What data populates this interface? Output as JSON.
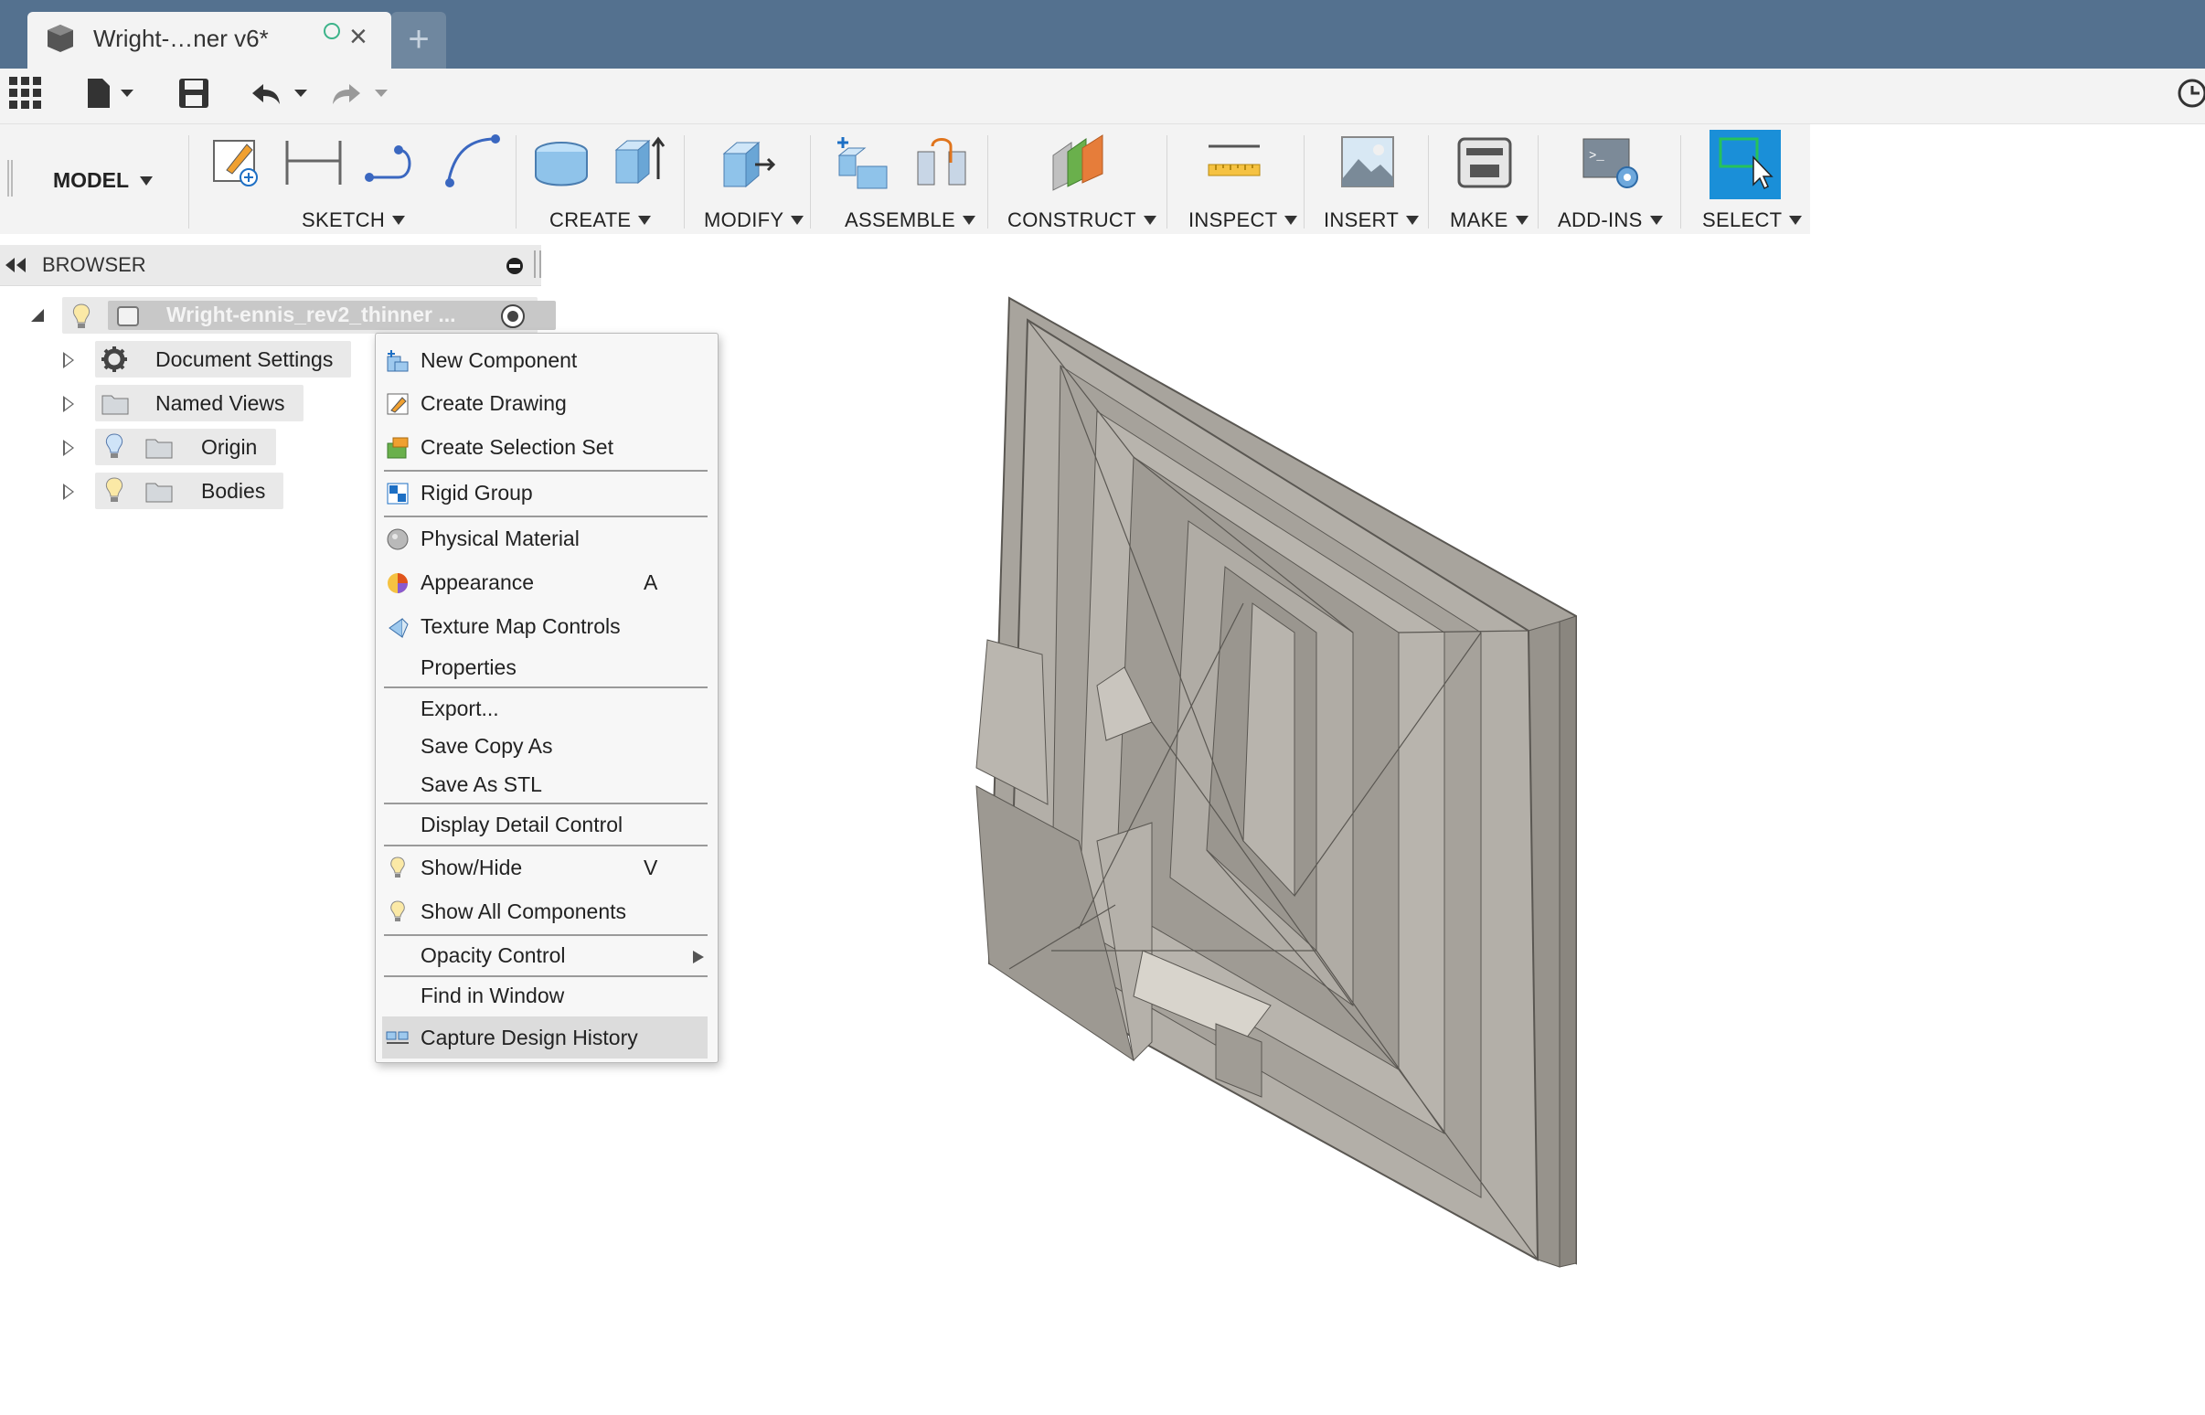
{
  "app": {
    "tab_title": "Wright-…ner v6*",
    "new_tab_symbol": "+"
  },
  "toolbar": {
    "workspace": "MODEL",
    "groups": {
      "sketch": "SKETCH",
      "create": "CREATE",
      "modify": "MODIFY",
      "assemble": "ASSEMBLE",
      "construct": "CONSTRUCT",
      "inspect": "INSPECT",
      "insert": "INSERT",
      "make": "MAKE",
      "addins": "ADD-INS",
      "select": "SELECT"
    }
  },
  "browser": {
    "title": "BROWSER",
    "root_label": "Wright-ennis_rev2_thinner ...",
    "items": [
      {
        "label": "Document Settings",
        "icon": "gear-icon"
      },
      {
        "label": "Named Views",
        "icon": "folder-icon"
      },
      {
        "label": "Origin",
        "icon": "folder-icon"
      },
      {
        "label": "Bodies",
        "icon": "folder-icon"
      }
    ]
  },
  "context_menu": {
    "items": [
      {
        "label": "New Component",
        "icon": "new-component-icon"
      },
      {
        "label": "Create Drawing",
        "icon": "create-drawing-icon"
      },
      {
        "label": "Create Selection Set",
        "icon": "selection-set-icon"
      },
      {
        "label": "Rigid Group",
        "icon": "rigid-group-icon"
      },
      {
        "label": "Physical Material",
        "icon": "physical-material-icon"
      },
      {
        "label": "Appearance",
        "shortcut": "A",
        "icon": "appearance-icon"
      },
      {
        "label": "Texture Map Controls",
        "icon": "texture-map-icon"
      },
      {
        "label": "Properties"
      },
      {
        "label": "Export..."
      },
      {
        "label": "Save Copy As"
      },
      {
        "label": "Save As STL"
      },
      {
        "label": "Display Detail Control"
      },
      {
        "label": "Show/Hide",
        "shortcut": "V",
        "icon": "lightbulb-icon"
      },
      {
        "label": "Show All Components",
        "icon": "lightbulb-icon"
      },
      {
        "label": "Opacity Control",
        "submenu": true
      },
      {
        "label": "Find in Window"
      },
      {
        "label": "Capture Design History",
        "icon": "design-history-icon",
        "highlighted": true
      }
    ]
  },
  "colors": {
    "titlebar": "#54718f",
    "toolbar_bg": "#f3f3f3",
    "select_accent": "#1a8fd8",
    "model_gray": "#a8a49d"
  }
}
